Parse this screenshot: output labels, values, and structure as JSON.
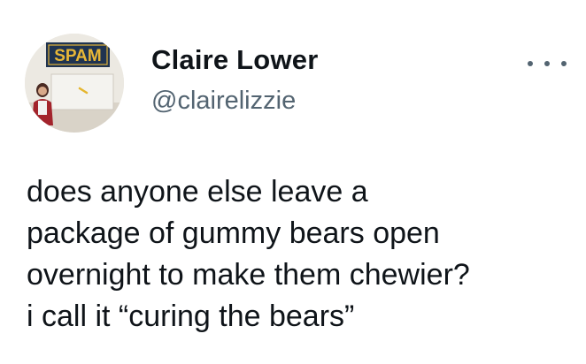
{
  "tweet": {
    "author": {
      "display_name": "Claire Lower",
      "handle": "@clairelizzie",
      "avatar_sign_text": "SPAM"
    },
    "more_icon": "more-horizontal-icon",
    "text": "does anyone else leave a\npackage of gummy bears open\novernight to make them chewier?\ni call it “curing the bears”"
  },
  "colors": {
    "text_primary": "#0f1419",
    "text_secondary": "#536471",
    "background": "#ffffff"
  }
}
